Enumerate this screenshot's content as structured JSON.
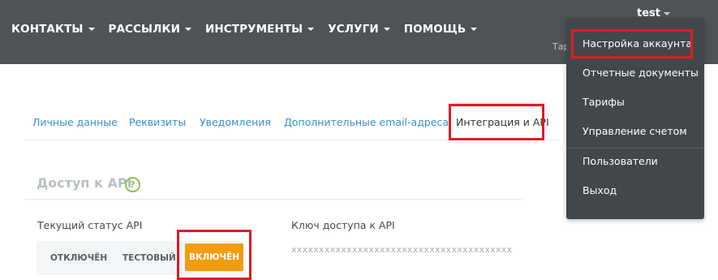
{
  "nav": {
    "items": [
      {
        "label": "КОНТАКТЫ"
      },
      {
        "label": "РАССЫЛКИ"
      },
      {
        "label": "ИНСТРУМЕНТЫ"
      },
      {
        "label": "УСЛУГИ"
      },
      {
        "label": "ПОМОЩЬ"
      }
    ],
    "user": "test",
    "tarif_partial": "Тар"
  },
  "dropdown": {
    "items": [
      {
        "label": "Настройка аккаунта"
      },
      {
        "label": "Отчетные документы"
      },
      {
        "label": "Тарифы"
      },
      {
        "label": "Управление счетом"
      },
      {
        "label": "Пользователи"
      },
      {
        "label": "Выход"
      }
    ]
  },
  "tabs": {
    "items": [
      {
        "label": "Личные данные"
      },
      {
        "label": "Реквизиты"
      },
      {
        "label": "Уведомления"
      },
      {
        "label": "Дополнительные email-адреса"
      },
      {
        "label": "Интеграция и API"
      }
    ],
    "active_index": 4
  },
  "api": {
    "title": "Доступ к API",
    "help_icon": "?",
    "status_label": "Текущий статус API",
    "statuses": [
      "ОТКЛЮЧЁН",
      "ТЕСТОВЫЙ",
      "ВКЛЮЧЁН"
    ],
    "active_status": "ВКЛЮЧЁН",
    "key_label": "Ключ доступа к API",
    "key_value": "xxxxxxxxxxxxxxxxxxxxxxxxxxxxxxxxxxxxxxxx"
  },
  "colors": {
    "topbar": "#4e5358",
    "link": "#3a8fc8",
    "accent": "#f39c12",
    "highlight": "#e01b24",
    "help": "#8bc34a"
  }
}
